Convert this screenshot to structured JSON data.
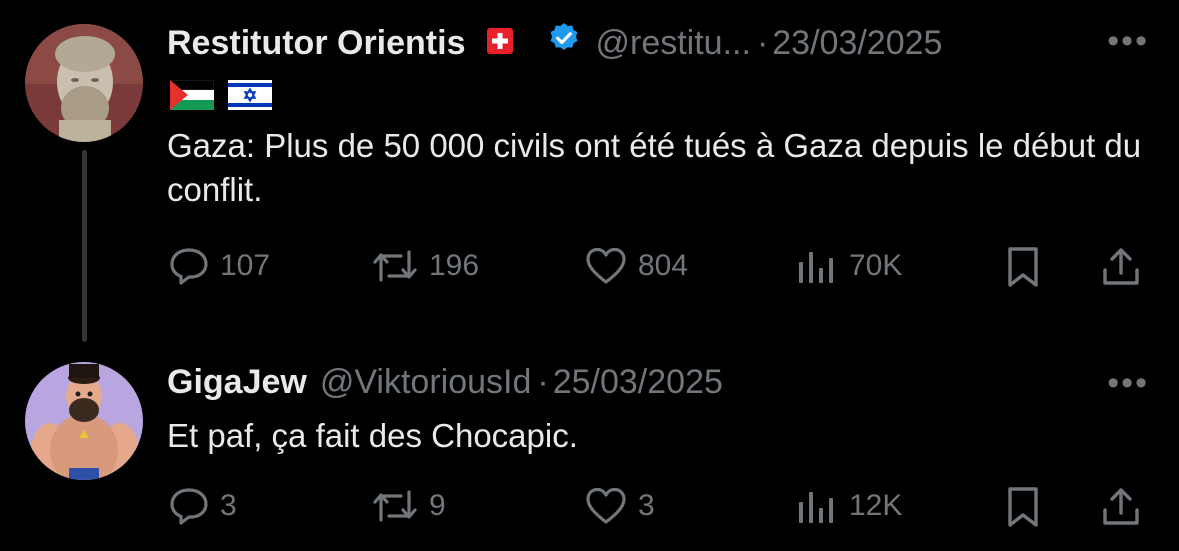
{
  "tweets": [
    {
      "display_name": "Restitutor Orientis",
      "handle": "@restitu...",
      "separator": "·",
      "date": "23/03/2025",
      "more": "•••",
      "text": "Gaza: Plus de 50 000 civils ont été tués à Gaza depuis le début du conflit.",
      "verified": true,
      "badges": [
        "swiss-flag-icon",
        "palestine-flag-icon",
        "israel-flag-icon"
      ],
      "actions": {
        "replies": "107",
        "reposts": "196",
        "likes": "804",
        "views": "70K"
      }
    },
    {
      "display_name": "GigaJew",
      "handle": "@ViktoriousId",
      "separator": "·",
      "date": "25/03/2025",
      "more": "•••",
      "text": "Et paf, ça fait des Chocapic.",
      "actions": {
        "replies": "3",
        "reposts": "9",
        "likes": "3",
        "views": "12K"
      }
    }
  ],
  "colors": {
    "background": "#000000",
    "text": "#e7e9ea",
    "muted": "#71767b",
    "verified": "#1d9bf0",
    "thread_line": "#333639"
  }
}
